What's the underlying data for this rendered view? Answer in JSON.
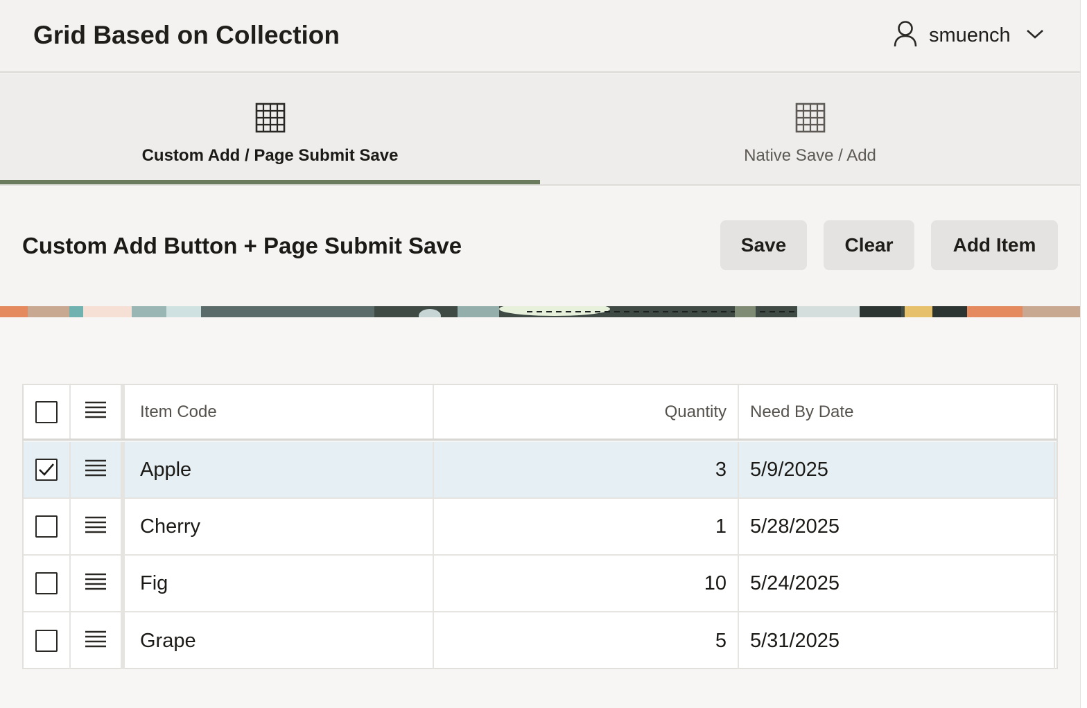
{
  "app": {
    "title": "Grid Based on Collection",
    "user": {
      "name": "smuench",
      "avatar_icon": "user-icon",
      "menu_icon": "chevron-down-icon"
    }
  },
  "tabs": [
    {
      "label": "Custom Add / Page Submit Save",
      "icon": "grid-icon",
      "active": true
    },
    {
      "label": "Native Save / Add",
      "icon": "grid-icon",
      "active": false
    }
  ],
  "region": {
    "title": "Custom Add Button + Page Submit Save",
    "buttons": {
      "save": "Save",
      "clear": "Clear",
      "add_item": "Add Item"
    }
  },
  "grid": {
    "columns": {
      "item_code": "Item Code",
      "quantity": "Quantity",
      "need_by_date": "Need By Date"
    },
    "rows": [
      {
        "item_code": "Apple",
        "quantity": "3",
        "need_by_date": "5/9/2025",
        "selected": true
      },
      {
        "item_code": "Cherry",
        "quantity": "1",
        "need_by_date": "5/28/2025",
        "selected": false
      },
      {
        "item_code": "Fig",
        "quantity": "10",
        "need_by_date": "5/24/2025",
        "selected": false
      },
      {
        "item_code": "Grape",
        "quantity": "5",
        "need_by_date": "5/31/2025",
        "selected": false
      }
    ]
  },
  "colors": {
    "accent_tab": "#6b7c5e",
    "selected_row": "#e5eff4",
    "button_bg": "#e4e3e1"
  }
}
